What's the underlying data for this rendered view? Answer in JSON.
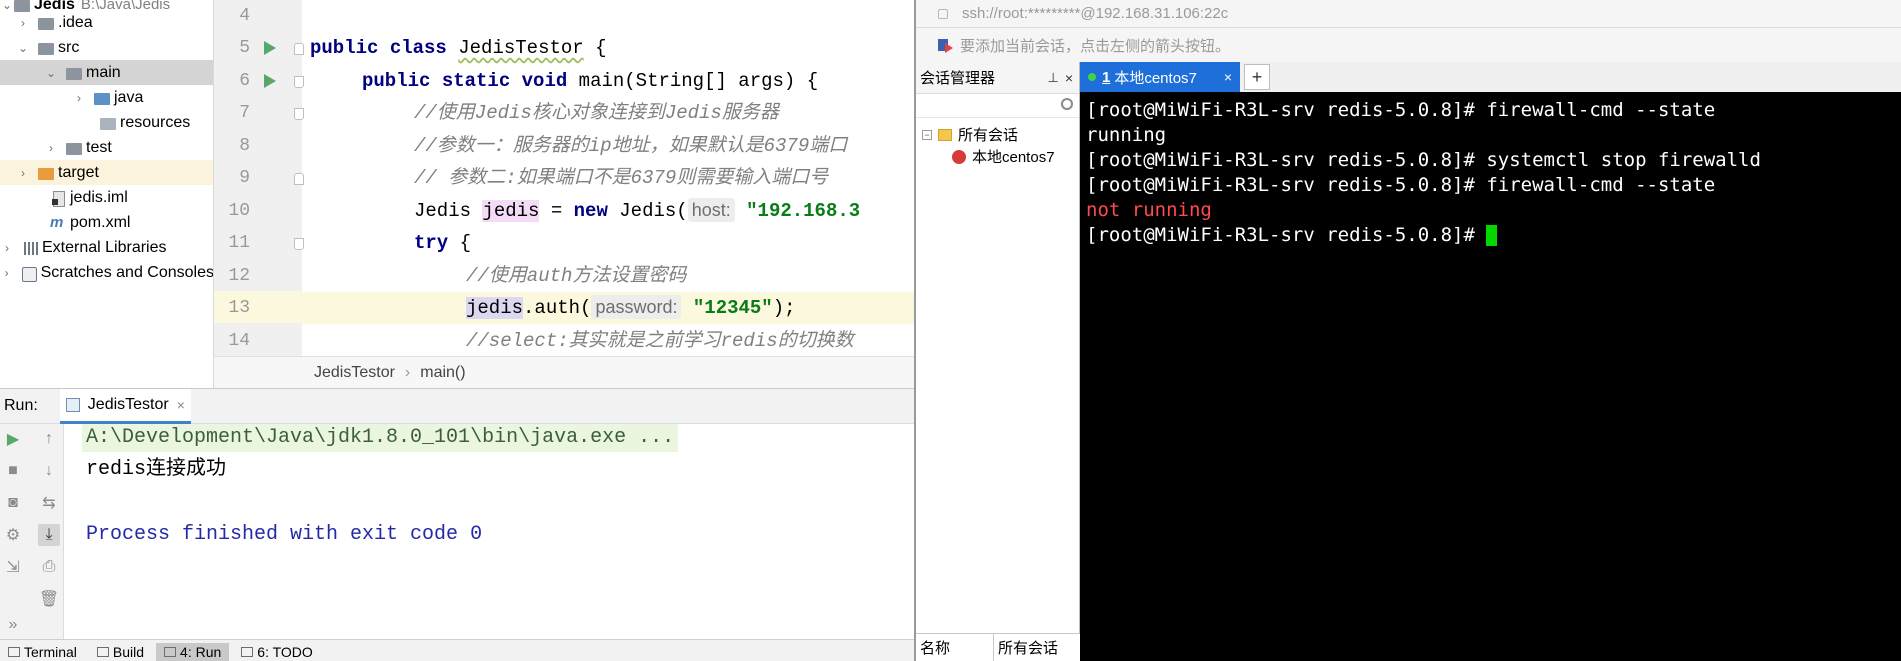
{
  "project": {
    "root_name": "Jedis",
    "root_path": "B:\\Java\\Jedis",
    "items": [
      {
        "label": ".idea"
      },
      {
        "label": "src"
      },
      {
        "label": "main"
      },
      {
        "label": "java"
      },
      {
        "label": "resources"
      },
      {
        "label": "test"
      },
      {
        "label": "target"
      },
      {
        "label": "jedis.iml"
      },
      {
        "label": "pom.xml"
      },
      {
        "label": "External Libraries"
      },
      {
        "label": "Scratches and Consoles"
      }
    ]
  },
  "editor": {
    "line_numbers": [
      "4",
      "5",
      "6",
      "7",
      "8",
      "9",
      "10",
      "11",
      "12",
      "13",
      "14"
    ],
    "line5": {
      "kw1": "public",
      "kw2": "class",
      "name": "JedisTestor",
      "rest": " {"
    },
    "line6": {
      "kw1": "public",
      "kw2": "static",
      "kw3": "void",
      "rest": " main(String[] args) {"
    },
    "line7": "//使用Jedis核心对象连接到Jedis服务器",
    "line8": "//参数一：服务器的ip地址，如果默认是6379端口",
    "line9": "// 参数二:如果端口不是6379则需要输入端口号",
    "line10": {
      "type": "Jedis ",
      "var": "jedis",
      "eq": " = ",
      "kw": "new",
      "ctor": " Jedis(",
      "hint": "host:",
      "str": "\"192.168.3"
    },
    "line11": {
      "kw": "try",
      "rest": " {"
    },
    "line12": "//使用auth方法设置密码",
    "line13": {
      "var": "jedis",
      "call": ".auth(",
      "hint": "password:",
      "str": "\"12345\"",
      "rest": ");"
    },
    "line14": "//select:其实就是之前学习redis的切换数"
  },
  "breadcrumb": {
    "class": "JedisTestor",
    "method": "main()"
  },
  "run": {
    "label": "Run:",
    "tab": "JedisTestor",
    "console": {
      "command": "A:\\Development\\Java\\jdk1.8.0_101\\bin\\java.exe ...",
      "output": "redis连接成功",
      "exit": "Process finished with exit code 0"
    }
  },
  "statusbar": {
    "items": [
      "Terminal",
      "Build",
      "4: Run",
      "6: TODO"
    ]
  },
  "xshell": {
    "address": "ssh://root:*********@192.168.31.106:22c",
    "hint": "要添加当前会话，点击左侧的箭头按钮。",
    "session_manager": {
      "title": "会话管理器",
      "pin": "⊥",
      "close": "×",
      "all_sessions": "所有会话",
      "session": "本地centos7",
      "footer_name": "名称",
      "footer_value": "所有会话"
    },
    "tab": {
      "number": "1",
      "label": "本地centos7",
      "close": "×",
      "add": "+"
    },
    "terminal": {
      "lines": [
        "[root@MiWiFi-R3L-srv redis-5.0.8]# firewall-cmd --state",
        "running",
        "[root@MiWiFi-R3L-srv redis-5.0.8]# systemctl stop firewalld",
        "[root@MiWiFi-R3L-srv redis-5.0.8]# firewall-cmd --state",
        "not running",
        "[root@MiWiFi-R3L-srv redis-5.0.8]# "
      ]
    }
  }
}
